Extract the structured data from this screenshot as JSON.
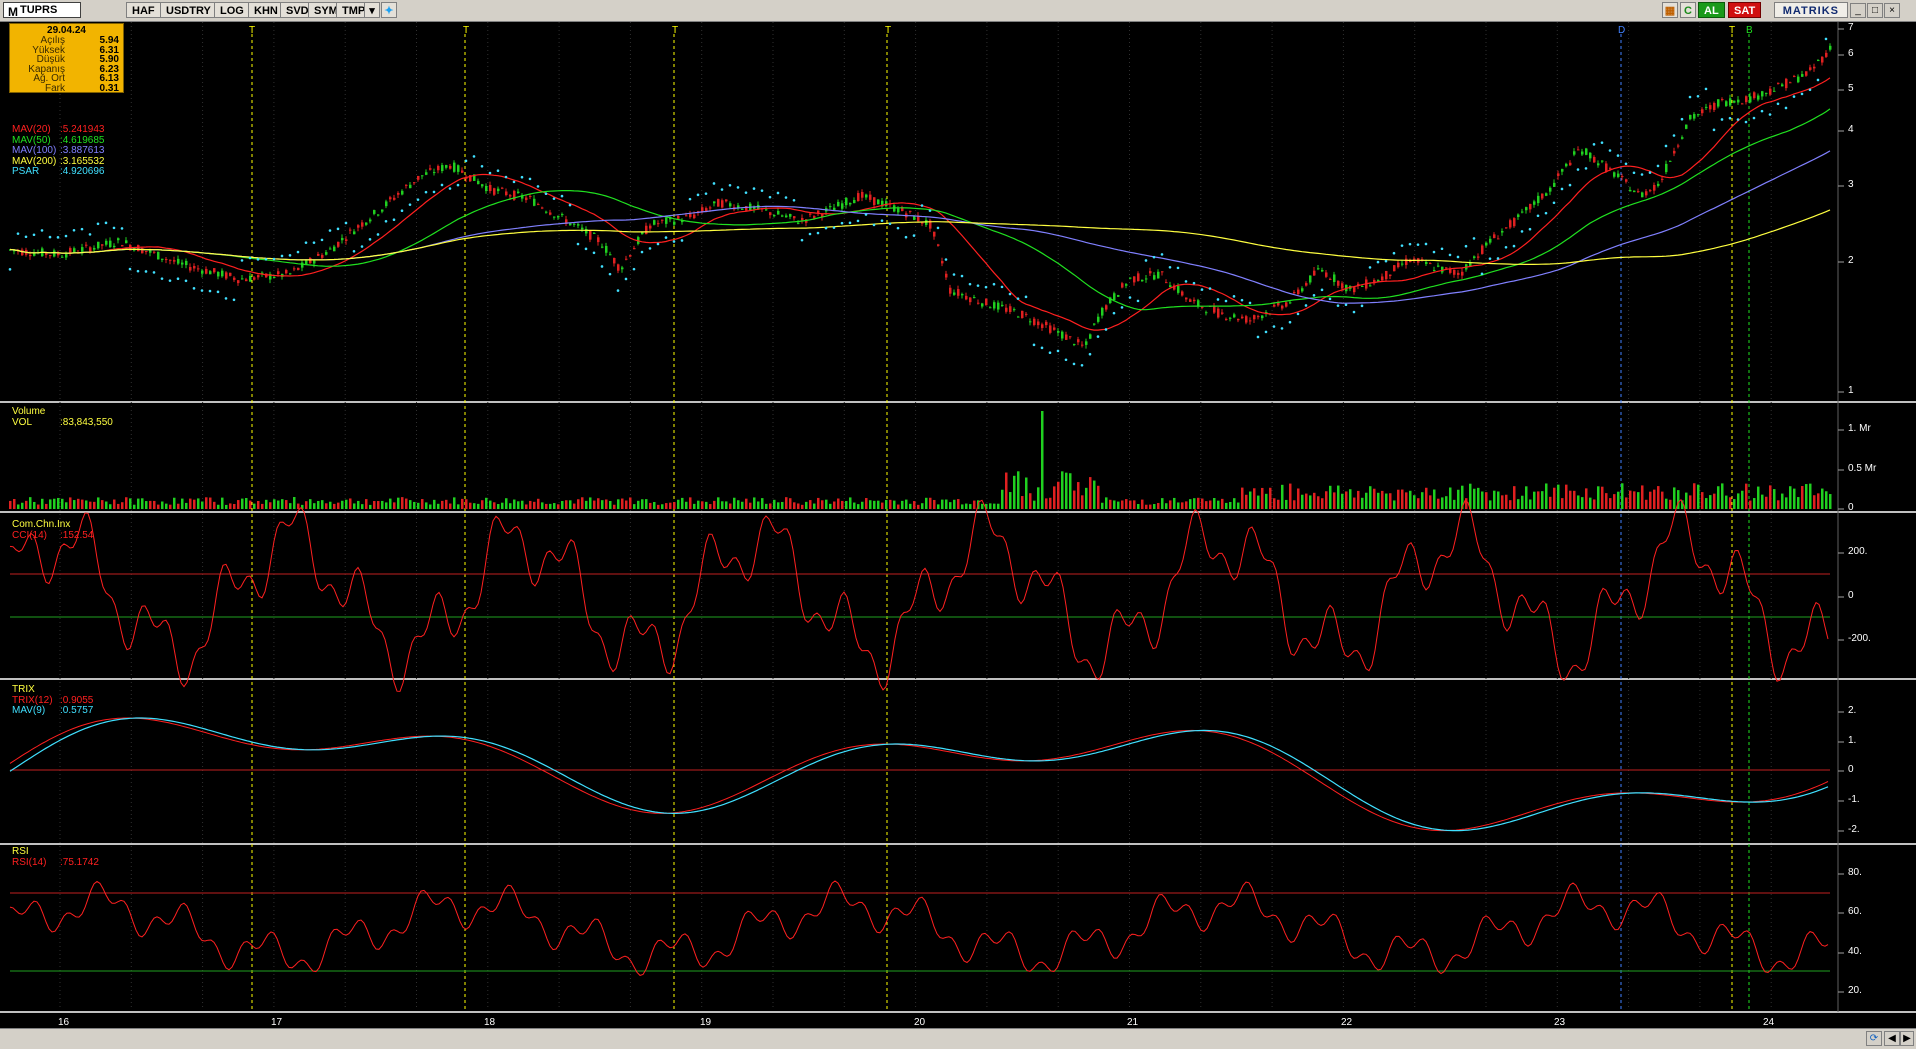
{
  "toolbar": {
    "logo": "M",
    "symbol": "TUPRS",
    "buttons": [
      "HAF",
      "USDTRY",
      "LOG",
      "KHN",
      "SVD",
      "SYM",
      "TMP"
    ],
    "al_label": "AL",
    "sat_label": "SAT",
    "brand": "MATRIKS",
    "c_label": "C"
  },
  "info_box": {
    "date": "29.04.24",
    "rows": [
      {
        "label": "Açılış",
        "value": "5.94"
      },
      {
        "label": "Yüksek",
        "value": "6.31"
      },
      {
        "label": "Düşük",
        "value": "5.90"
      },
      {
        "label": "Kapanış",
        "value": "6.23"
      },
      {
        "label": "Ağ. Ort",
        "value": "6.13"
      },
      {
        "label": "Fark",
        "value": "0.31"
      }
    ]
  },
  "price_panel": {
    "legend": [
      {
        "label": "MAV(20)",
        "value": ":5.241943",
        "color": "#ff2020"
      },
      {
        "label": "MAV(50)",
        "value": ":4.619685",
        "color": "#20e020"
      },
      {
        "label": "MAV(100)",
        "value": ":3.887613",
        "color": "#8080ff"
      },
      {
        "label": "MAV(200)",
        "value": ":3.165532",
        "color": "#ffff40"
      },
      {
        "label": "PSAR",
        "value": ":4.920696",
        "color": "#40e0ff"
      }
    ],
    "y_ticks": [
      "7",
      "6",
      "5",
      "4",
      "3",
      "2",
      "1"
    ],
    "markers": [
      {
        "label": "T",
        "color": "#ffff00"
      },
      {
        "label": "T",
        "color": "#ffff00"
      },
      {
        "label": "T",
        "color": "#ffff00"
      },
      {
        "label": "T",
        "color": "#ffff00"
      },
      {
        "label": "D",
        "color": "#4080ff"
      },
      {
        "label": "T",
        "color": "#ffff00"
      },
      {
        "label": "B",
        "color": "#20e020"
      }
    ]
  },
  "volume_panel": {
    "title": "Volume",
    "legend_label": "VOL",
    "legend_value": ":83,843,550",
    "y_ticks": [
      "1. Mr",
      "0.5 Mr",
      "0"
    ]
  },
  "cci_panel": {
    "title": "Com.Chn.Inx",
    "legend_label": "CCI(14)",
    "legend_value": ":152.54",
    "y_ticks": [
      "200.",
      "0",
      "-200."
    ]
  },
  "trix_panel": {
    "title": "TRIX",
    "legend": [
      {
        "label": "TRIX(12)",
        "value": ":0.9055",
        "color": "#ff2020"
      },
      {
        "label": "MAV(9)",
        "value": ":0.5757",
        "color": "#40e0ff"
      }
    ],
    "y_ticks": [
      "2.",
      "1.",
      "0",
      "-1.",
      "-2."
    ]
  },
  "rsi_panel": {
    "title": "RSI",
    "legend_label": "RSI(14)",
    "legend_value": ":75.1742",
    "y_ticks": [
      "80.",
      "60.",
      "40.",
      "20."
    ]
  },
  "x_axis": {
    "labels": [
      "16",
      "17",
      "18",
      "19",
      "20",
      "21",
      "22",
      "23",
      "24"
    ]
  },
  "colors": {
    "up": "#20d020",
    "down": "#e02020",
    "psar": "#40e0ff",
    "grid": "#303030",
    "separator": "#c0c0c0"
  }
}
